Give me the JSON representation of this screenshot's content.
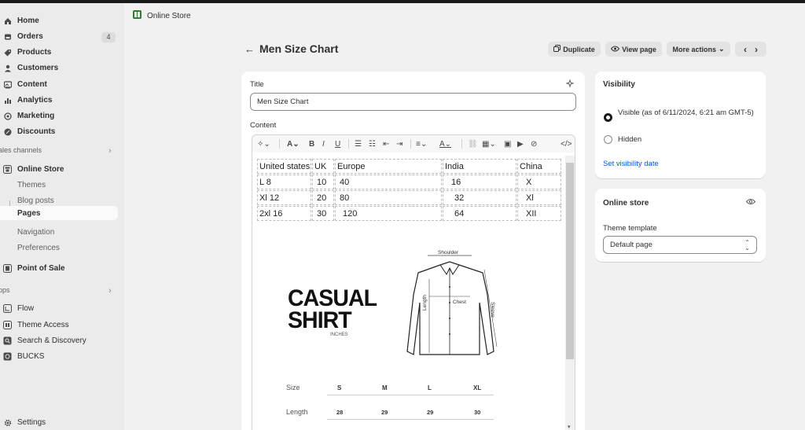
{
  "sidebar": {
    "items": [
      {
        "label": "Home",
        "icon": "home-icon"
      },
      {
        "label": "Orders",
        "icon": "orders-icon",
        "badge": "4"
      },
      {
        "label": "Products",
        "icon": "tag-icon"
      },
      {
        "label": "Customers",
        "icon": "person-icon"
      },
      {
        "label": "Content",
        "icon": "content-icon"
      },
      {
        "label": "Analytics",
        "icon": "bar-chart-icon"
      },
      {
        "label": "Marketing",
        "icon": "target-icon"
      },
      {
        "label": "Discounts",
        "icon": "discount-icon"
      }
    ],
    "sales_channels_label": "ales channels",
    "online_store": {
      "label": "Online Store",
      "subitems": [
        "Themes",
        "Blog posts",
        "Pages",
        "Navigation",
        "Preferences"
      ]
    },
    "point_of_sale": "Point of Sale",
    "apps_label": "pps",
    "apps": [
      "Flow",
      "Theme Access",
      "Search & Discovery",
      "BUCKS"
    ],
    "settings": "Settings"
  },
  "breadcrumb": {
    "label": "Online Store"
  },
  "header": {
    "title": "Men Size Chart",
    "duplicate": "Duplicate",
    "view_page": "View page",
    "more_actions": "More actions"
  },
  "editor": {
    "title_label": "Title",
    "title_value": "Men Size Chart",
    "content_label": "Content",
    "table": [
      [
        "United states",
        "UK",
        "Europe",
        "India",
        "China"
      ],
      [
        "L  8",
        "10",
        "40",
        "16",
        "X"
      ],
      [
        "Xl  12",
        "20",
        "80",
        "32",
        "Xl"
      ],
      [
        "2xl  16",
        "30",
        "120",
        "64",
        "XII"
      ]
    ],
    "image": {
      "casual": "CASUAL",
      "shirt": "SHIRT",
      "inches": "INCHES",
      "shoulder": "Shoulder",
      "chest": "Chest",
      "length": "Length",
      "sleeve": "Sleeve",
      "size_label": "Size",
      "length_label": "Length",
      "sizes": [
        "S",
        "M",
        "L",
        "XL"
      ],
      "lengths": [
        "28",
        "29",
        "29",
        "30"
      ]
    }
  },
  "visibility": {
    "title": "Visibility",
    "visible_label": "Visible (as of 6/11/2024, 6:21 am GMT-5)",
    "hidden_label": "Hidden",
    "set_date": "Set visibility date"
  },
  "online_store_card": {
    "title": "Online store",
    "template_label": "Theme template",
    "template_value": "Default page"
  },
  "colors": {
    "link": "#005bd3",
    "sidebar_bg": "#ebebeb",
    "page_bg": "#f1f1f1"
  }
}
